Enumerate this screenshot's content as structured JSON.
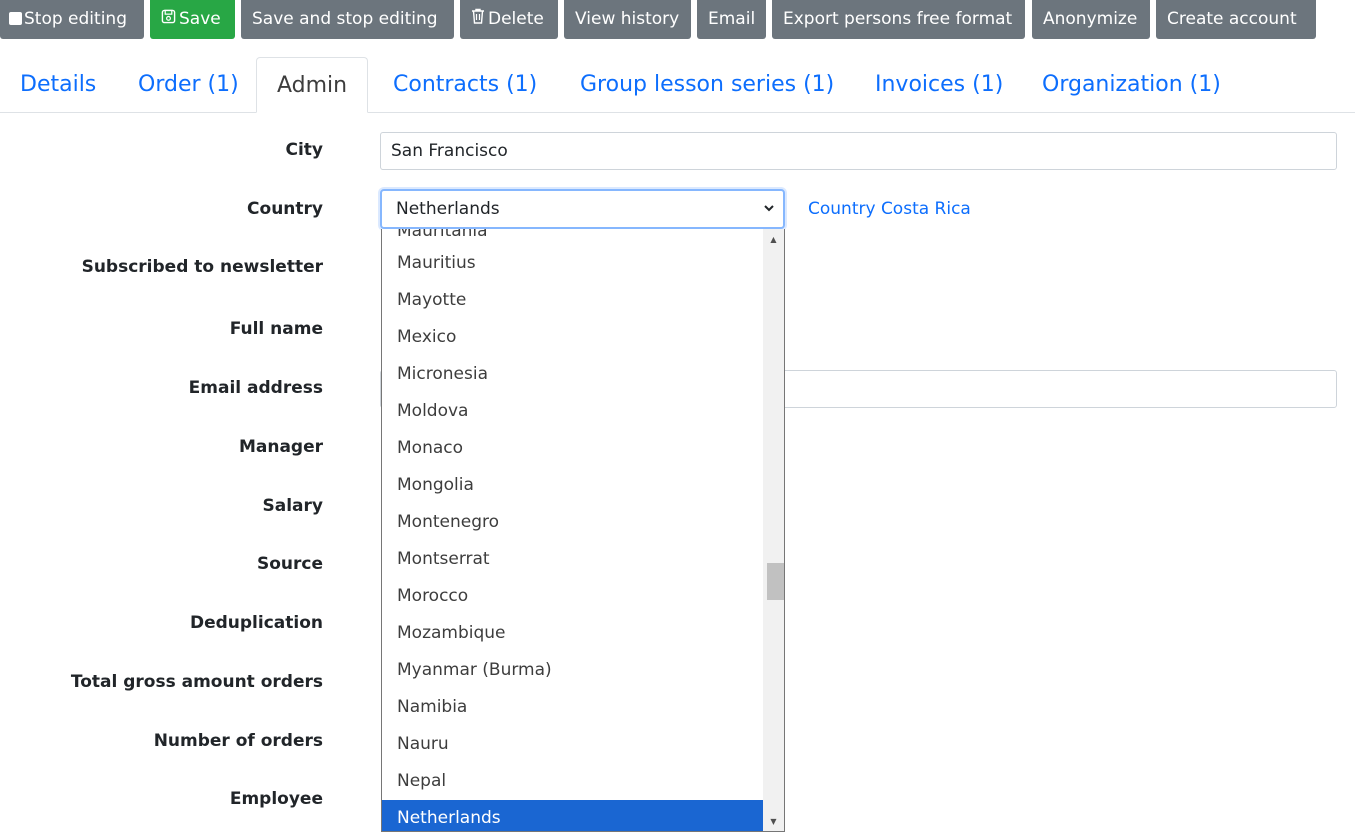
{
  "toolbar": {
    "stop_editing": "Stop editing",
    "save": "Save",
    "save_stop": "Save and stop editing",
    "delete": "Delete",
    "view_history": "View history",
    "email": "Email",
    "export": "Export persons free format",
    "anonymize": "Anonymize",
    "create_account": "Create account"
  },
  "tabs": [
    "Details",
    "Order (1)",
    "Admin",
    "Contracts (1)",
    "Group lesson series (1)",
    "Invoices (1)",
    "Organization (1)"
  ],
  "active_tab": "Admin",
  "form": {
    "city_label": "City",
    "city_value": "San Francisco",
    "country_label": "Country",
    "country_value": "Netherlands",
    "country_link": "Country Costa Rica",
    "labels": [
      "Subscribed to newsletter",
      "Full name",
      "Email address",
      "Manager",
      "Salary",
      "Source",
      "Deduplication",
      "Total gross amount orders",
      "Number of orders",
      "Employee"
    ]
  },
  "dropdown": {
    "options": [
      "Mauritania",
      "Mauritius",
      "Mayotte",
      "Mexico",
      "Micronesia",
      "Moldova",
      "Monaco",
      "Mongolia",
      "Montenegro",
      "Montserrat",
      "Morocco",
      "Mozambique",
      "Myanmar (Burma)",
      "Namibia",
      "Nauru",
      "Nepal",
      "Netherlands"
    ],
    "selected": "Netherlands"
  },
  "colors": {
    "primary_link": "#0d6efd",
    "secondary_button": "#6c757d",
    "success_button": "#28a745",
    "selected_option": "#1a66d2"
  }
}
